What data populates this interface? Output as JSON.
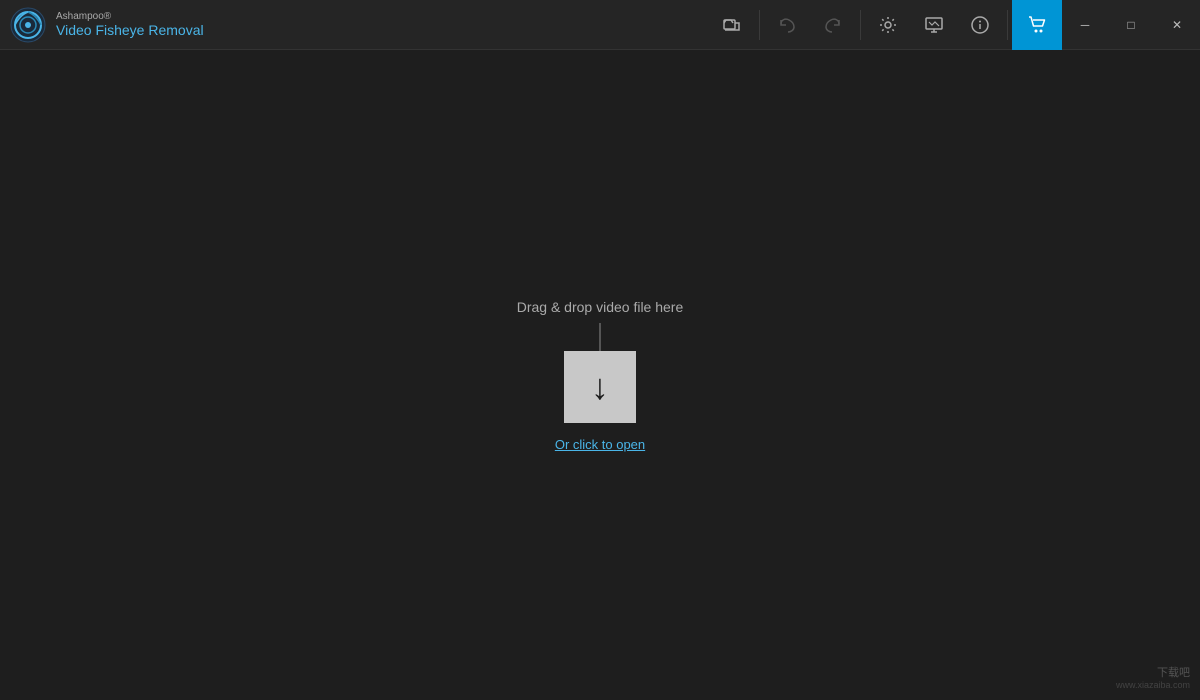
{
  "titlebar": {
    "brand": "Ashampoo®",
    "appname": "Video Fisheye Removal"
  },
  "toolbar": {
    "open_label": "📂",
    "undo_label": "↩",
    "redo_label": "↪",
    "settings_label": "⚙",
    "display_label": "🖥",
    "info_label": "ℹ",
    "buy_label": "🛒"
  },
  "window_controls": {
    "minimize": "─",
    "maximize": "□",
    "close": "✕"
  },
  "main": {
    "drag_text": "Drag & drop video file here",
    "click_open": "Or click to open"
  },
  "watermark": {
    "line1": "下载吧",
    "line2": "www.xiazaiba.com"
  }
}
